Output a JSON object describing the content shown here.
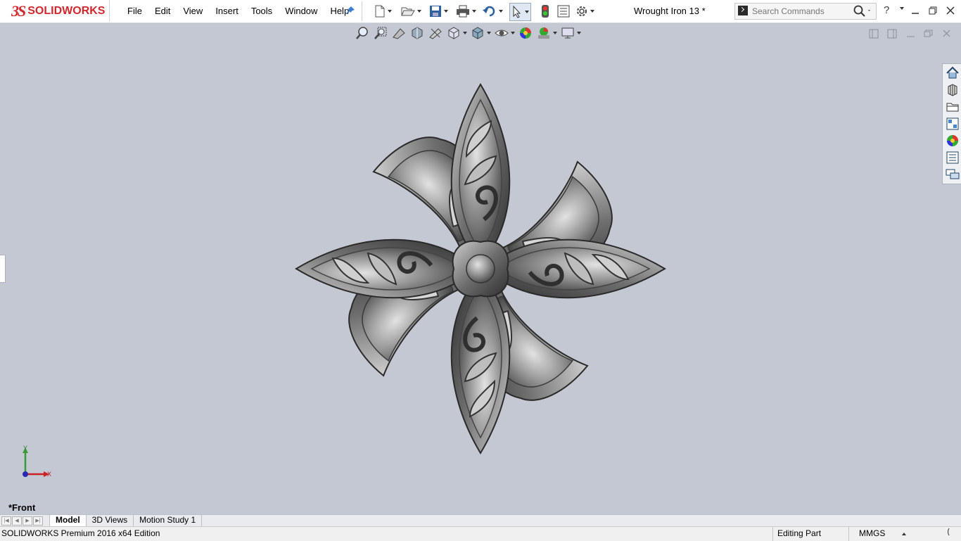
{
  "app": {
    "logo_ds": "3S",
    "logo_name": "SOLIDWORKS",
    "document_title": "Wrought Iron 13 *"
  },
  "menu": [
    "File",
    "Edit",
    "View",
    "Insert",
    "Tools",
    "Window",
    "Help"
  ],
  "search": {
    "placeholder": "Search Commands"
  },
  "help_label": "?",
  "viewport": {
    "view_name": "*Front",
    "triad_y": "Y",
    "triad_x": "X",
    "background": "#c4c8d2"
  },
  "tabs": [
    {
      "label": "Model",
      "active": true
    },
    {
      "label": "3D Views",
      "active": false
    },
    {
      "label": "Motion Study 1",
      "active": false
    }
  ],
  "status": {
    "edition": "SOLIDWORKS Premium 2016 x64 Edition",
    "mode": "Editing Part",
    "units": "MMGS"
  },
  "colors": {
    "brand": "#d2282e",
    "metal_dark": "#3c3c3c",
    "metal_light": "#d8d8d8"
  }
}
